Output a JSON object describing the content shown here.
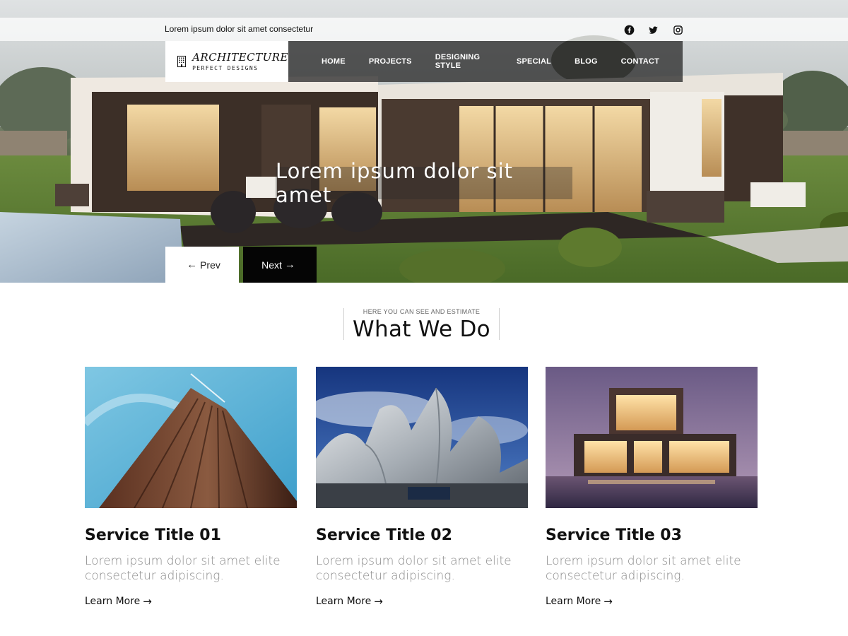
{
  "header": {
    "tagline": "Lorem ipsum dolor sit amet consectetur",
    "social_icons": [
      "facebook-icon",
      "twitter-icon",
      "instagram-icon"
    ]
  },
  "logo": {
    "name": "ARCHITECTURE",
    "subtitle": "PERFECT DESIGNS"
  },
  "nav": {
    "items": [
      "HOME",
      "PROJECTS",
      "DESIGNING STYLE",
      "SPECIAL",
      "BLOG",
      "CONTACT"
    ]
  },
  "hero": {
    "title": "Lorem ipsum dolor sit amet",
    "prev_label": "Prev",
    "next_label": "Next",
    "prev_icon": "arrow-left-icon",
    "next_icon": "arrow-right-icon"
  },
  "services_section": {
    "kicker": "HERE YOU CAN SEE AND ESTIMATE",
    "title": "What We Do",
    "cards": [
      {
        "title": "Service Title 01",
        "text": "Lorem ipsum dolor sit amet elite consectetur adipiscing.",
        "link": "Learn More",
        "image": "skyscraper-photo"
      },
      {
        "title": "Service Title 02",
        "text": "Lorem ipsum dolor sit amet elite consectetur adipiscing.",
        "link": "Learn More",
        "image": "metal-concert-hall-photo"
      },
      {
        "title": "Service Title 03",
        "text": "Lorem ipsum dolor sit amet elite consectetur adipiscing.",
        "link": "Learn More",
        "image": "modern-house-dusk-photo"
      }
    ]
  },
  "colors": {
    "nav_bg": "#2d2d2d",
    "accent_dark": "#050505",
    "body_text_muted": "#8b8b8b",
    "white": "#ffffff"
  }
}
